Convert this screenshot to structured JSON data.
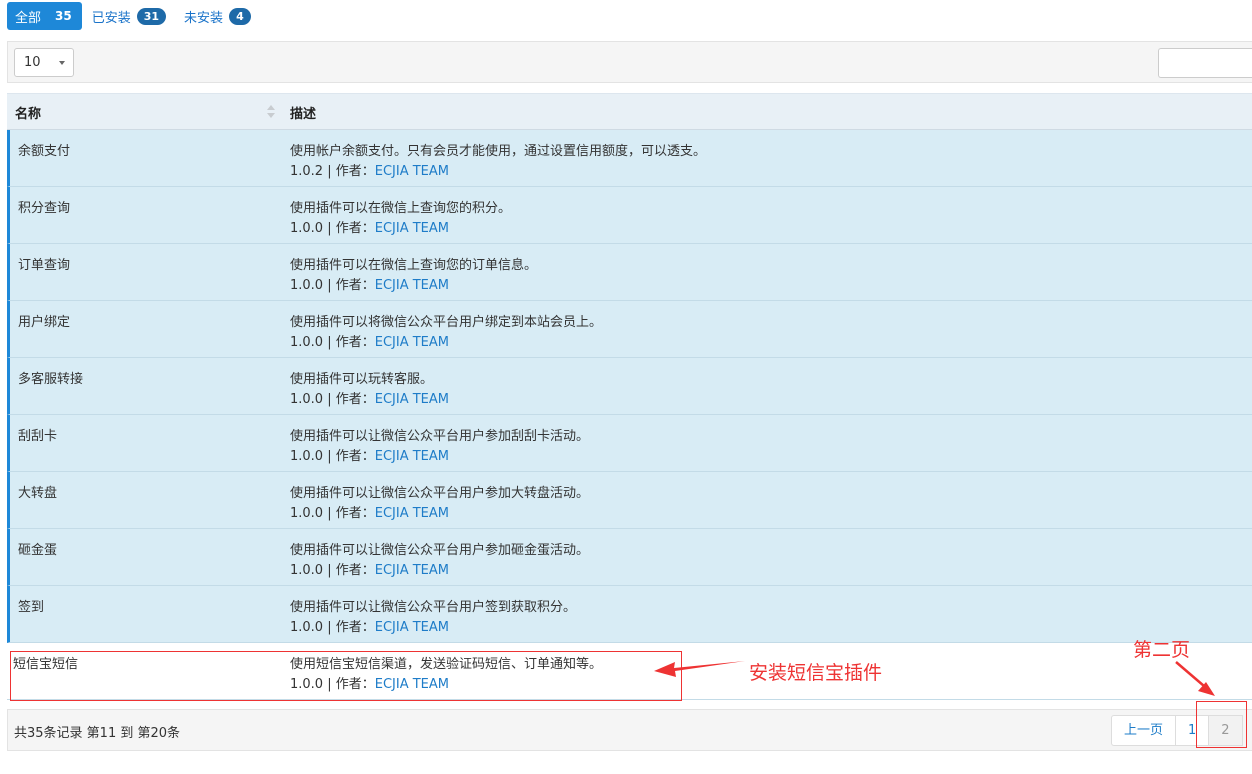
{
  "filters": [
    {
      "label": "全部",
      "count": "35"
    },
    {
      "label": "已安装",
      "count": "31"
    },
    {
      "label": "未安装",
      "count": "4"
    }
  ],
  "page_size": "10",
  "table": {
    "headers": {
      "name": "名称",
      "desc": "描述"
    },
    "rows": [
      {
        "name": "余额支付",
        "desc": "使用帐户余额支付。只有会员才能使用，通过设置信用额度，可以透支。",
        "version": "1.0.2",
        "author_prefix": " | 作者：",
        "author": "ECJIA TEAM"
      },
      {
        "name": "积分查询",
        "desc": "使用插件可以在微信上查询您的积分。",
        "version": "1.0.0",
        "author_prefix": " | 作者：",
        "author": "ECJIA TEAM"
      },
      {
        "name": "订单查询",
        "desc": "使用插件可以在微信上查询您的订单信息。",
        "version": "1.0.0",
        "author_prefix": " | 作者：",
        "author": "ECJIA TEAM"
      },
      {
        "name": "用户绑定",
        "desc": "使用插件可以将微信公众平台用户绑定到本站会员上。",
        "version": "1.0.0",
        "author_prefix": " | 作者：",
        "author": "ECJIA TEAM"
      },
      {
        "name": "多客服转接",
        "desc": "使用插件可以玩转客服。",
        "version": "1.0.0",
        "author_prefix": " | 作者：",
        "author": "ECJIA TEAM"
      },
      {
        "name": "刮刮卡",
        "desc": "使用插件可以让微信公众平台用户参加刮刮卡活动。",
        "version": "1.0.0",
        "author_prefix": " | 作者：",
        "author": "ECJIA TEAM"
      },
      {
        "name": "大转盘",
        "desc": "使用插件可以让微信公众平台用户参加大转盘活动。",
        "version": "1.0.0",
        "author_prefix": " | 作者：",
        "author": "ECJIA TEAM"
      },
      {
        "name": "砸金蛋",
        "desc": "使用插件可以让微信公众平台用户参加砸金蛋活动。",
        "version": "1.0.0",
        "author_prefix": " | 作者：",
        "author": "ECJIA TEAM"
      },
      {
        "name": "签到",
        "desc": "使用插件可以让微信公众平台用户签到获取积分。",
        "version": "1.0.0",
        "author_prefix": " | 作者：",
        "author": "ECJIA TEAM"
      },
      {
        "name": "短信宝短信",
        "desc": "使用短信宝短信渠道，发送验证码短信、订单通知等。",
        "version": "1.0.0",
        "author_prefix": " | 作者：",
        "author": "ECJIA TEAM"
      }
    ]
  },
  "footer": {
    "summary": "共35条记录 第11 到 第20条",
    "prev_label": "上一页",
    "pages": [
      "1",
      "2"
    ]
  },
  "annotations": {
    "install_label": "安装短信宝插件",
    "page2_label": "第二页",
    "color": "#e33333"
  }
}
